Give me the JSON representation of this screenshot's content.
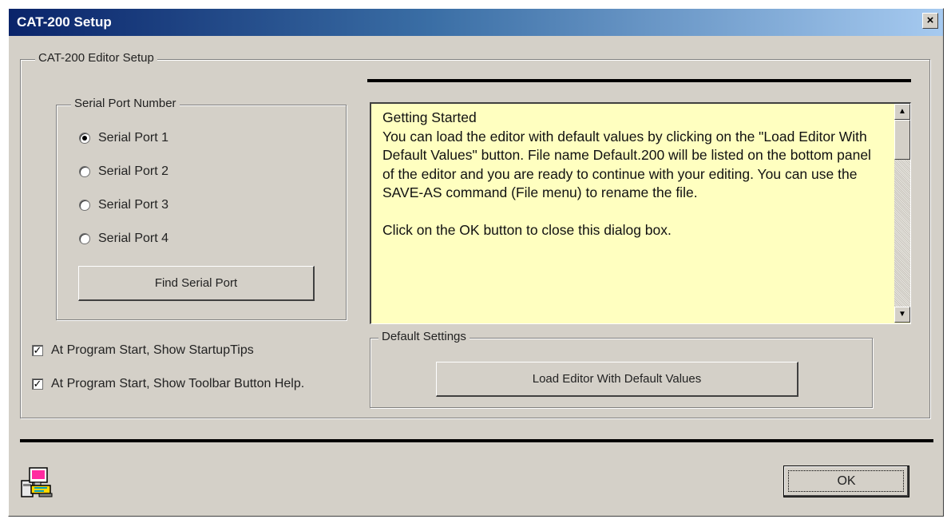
{
  "window": {
    "title": "CAT-200 Setup",
    "close_label": "×"
  },
  "editor_setup": {
    "legend": "CAT-200 Editor Setup",
    "serial_port": {
      "legend": "Serial Port Number",
      "options": [
        {
          "label": "Serial Port 1",
          "selected": true
        },
        {
          "label": "Serial Port 2",
          "selected": false
        },
        {
          "label": "Serial Port 3",
          "selected": false
        },
        {
          "label": "Serial Port 4",
          "selected": false
        }
      ],
      "find_button": "Find Serial Port"
    },
    "checkboxes": [
      {
        "label": "At Program Start, Show StartupTips",
        "checked": true,
        "mark": "✓"
      },
      {
        "label": "At Program Start, Show Toolbar Button Help.",
        "checked": true,
        "mark": "✓"
      }
    ],
    "getting_started": {
      "heading": "Getting Started",
      "paragraph1": "You can load the editor with default values by clicking on the \"Load Editor With Default Values\" button. File name Default.200 will be listed on the bottom panel of the editor and you are ready to continue with your editing.  You can use the SAVE-AS command (File menu) to rename the file.",
      "paragraph2": "Click on the OK button to close this dialog box.",
      "scroll_up": "▲",
      "scroll_down": "▼"
    },
    "default_settings": {
      "legend": "Default Settings",
      "load_button": "Load Editor With Default Values"
    }
  },
  "ok_button": "OK",
  "icons": {
    "app": "computer-setup-icon"
  },
  "colors": {
    "titlebar_start": "#0a246a",
    "titlebar_end": "#a6caf0",
    "textbox_bg": "#ffffc0",
    "face": "#d4d0c8"
  }
}
